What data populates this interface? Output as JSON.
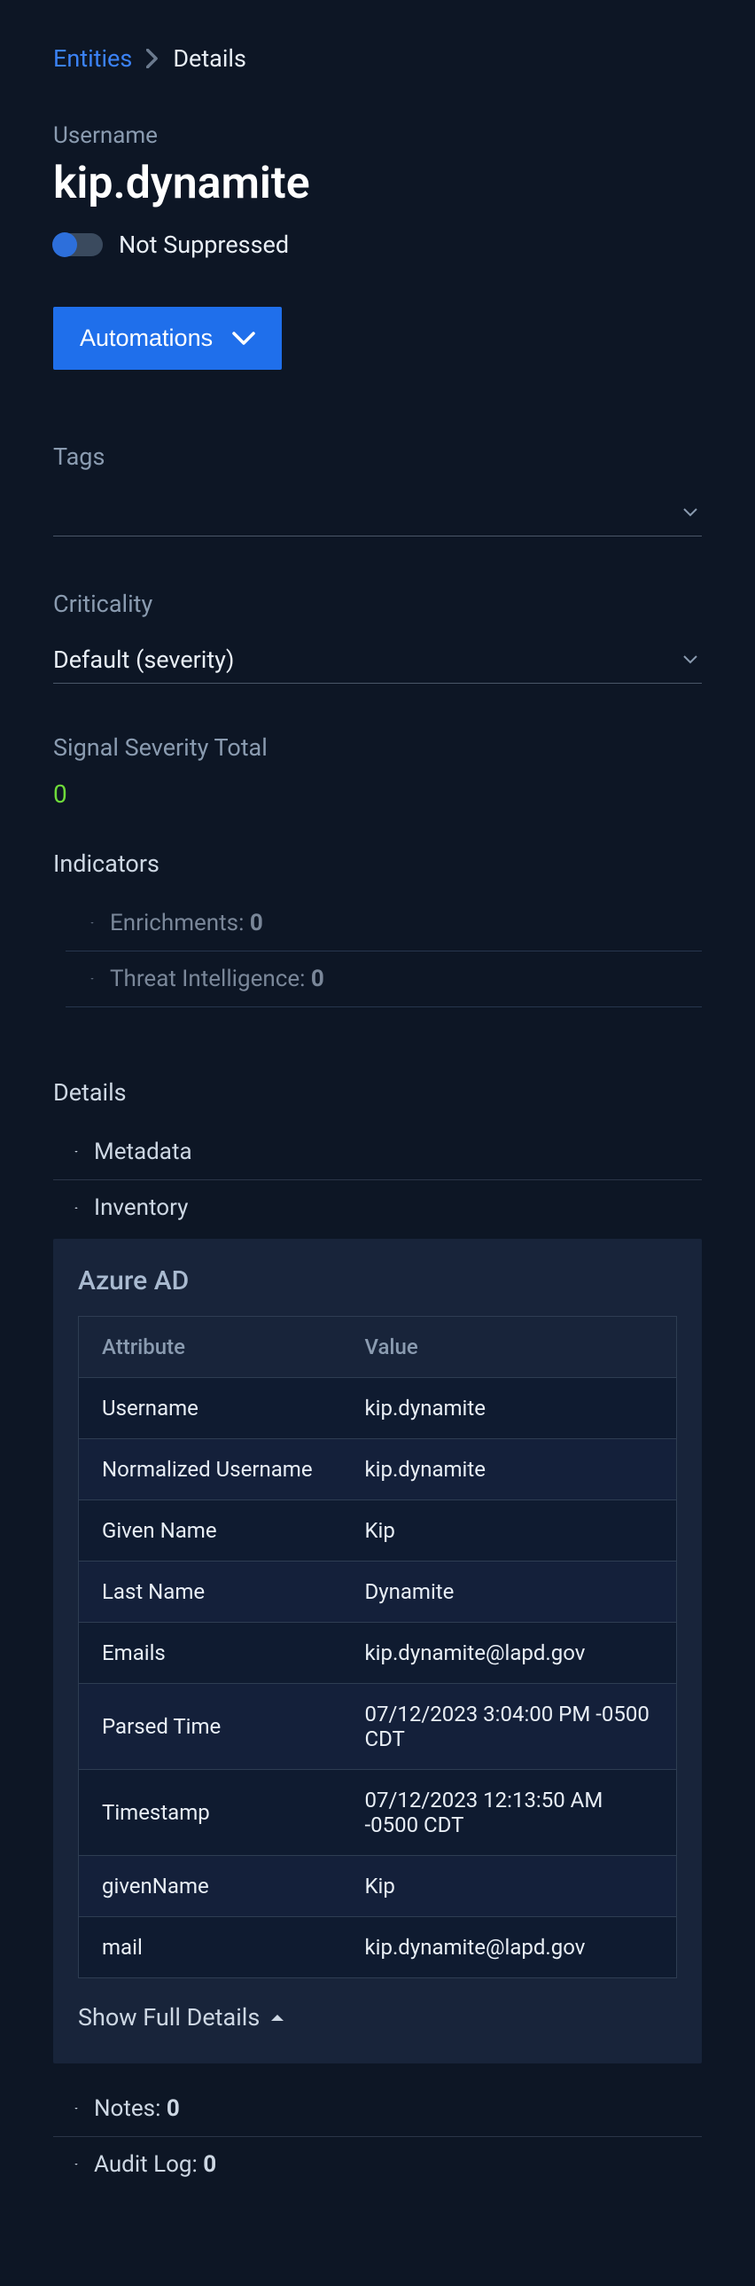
{
  "breadcrumb": {
    "root": "Entities",
    "current": "Details"
  },
  "header": {
    "label": "Username",
    "entity": "kip.dynamite",
    "suppress_label": "Not Suppressed",
    "automations_label": "Automations"
  },
  "tags": {
    "label": "Tags",
    "value": ""
  },
  "criticality": {
    "label": "Criticality",
    "value": "Default (severity)"
  },
  "severity": {
    "label": "Signal Severity Total",
    "value": "0"
  },
  "indicators": {
    "label": "Indicators",
    "items": [
      {
        "label": "Enrichments: ",
        "count": "0"
      },
      {
        "label": "Threat Intelligence: ",
        "count": "0"
      }
    ]
  },
  "details": {
    "label": "Details",
    "metadata_label": "Metadata",
    "inventory_label": "Inventory",
    "panel_title": "Azure AD",
    "col_attr": "Attribute",
    "col_val": "Value",
    "rows": [
      {
        "attr": "Username",
        "val": "kip.dynamite"
      },
      {
        "attr": "Normalized Username",
        "val": "kip.dynamite"
      },
      {
        "attr": "Given Name",
        "val": "Kip"
      },
      {
        "attr": "Last Name",
        "val": "Dynamite"
      },
      {
        "attr": "Emails",
        "val": "kip.dynamite@lapd.gov"
      },
      {
        "attr": "Parsed Time",
        "val": "07/12/2023 3:04:00 PM -0500 CDT"
      },
      {
        "attr": "Timestamp",
        "val": "07/12/2023 12:13:50 AM -0500 CDT"
      },
      {
        "attr": "givenName",
        "val": "Kip"
      },
      {
        "attr": "mail",
        "val": "kip.dynamite@lapd.gov"
      }
    ],
    "show_full": "Show Full Details",
    "notes": {
      "prefix": "Notes: ",
      "count": "0"
    },
    "audit": {
      "prefix": "Audit Log: ",
      "count": "0"
    }
  }
}
